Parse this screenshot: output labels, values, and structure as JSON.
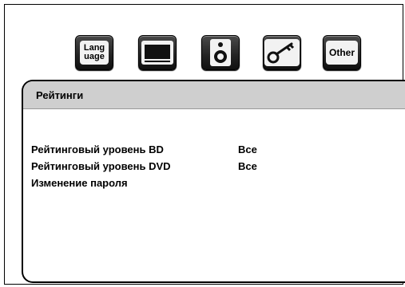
{
  "tabs": {
    "language": {
      "line1": "Lang",
      "line2": "uage",
      "icon": "language-icon"
    },
    "display": {
      "icon": "display-icon"
    },
    "audio": {
      "icon": "speaker-icon"
    },
    "parental": {
      "icon": "key-icon"
    },
    "other": {
      "label": "Other",
      "icon": "other-icon"
    }
  },
  "panel": {
    "title": "Рейтинги",
    "rows": [
      {
        "label": "Рейтинговый уровень BD",
        "value": "Все"
      },
      {
        "label": "Рейтинговый уровень DVD",
        "value": "Все"
      },
      {
        "label": "Изменение пароля",
        "value": ""
      }
    ]
  },
  "colors": {
    "tab_background": "#222222",
    "header_background": "#cfcfcf"
  }
}
